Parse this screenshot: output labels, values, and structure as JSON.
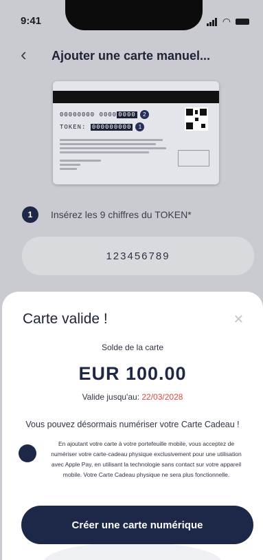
{
  "status_bar": {
    "time": "9:41"
  },
  "header": {
    "back_icon": "chevron-left-icon",
    "title": "Ajouter une carte manuel..."
  },
  "card_preview": {
    "card_number_prefix": "00000000 0000",
    "card_number_highlight": "0000",
    "card_number_badge": "2",
    "token_label": "TOKEN:",
    "token_highlight": "000000000",
    "token_badge": "1"
  },
  "step": {
    "number": "1",
    "text": "Insérez les 9 chiffres du TOKEN*"
  },
  "token_input": {
    "value": "123456789"
  },
  "sheet": {
    "title": "Carte valide !",
    "close_icon": "close-icon",
    "balance_label": "Solde de la carte",
    "balance_amount": "EUR 100.00",
    "valid_until_label": "Valide jusqu'au:",
    "valid_until_date": "22/03/2028",
    "message": "Vous pouvez désormais numériser votre Carte Cadeau !",
    "disclaimer": "En ajoutant votre carte à votre portefeuille mobile, vous acceptez de numériser votre carte-cadeau physique exclusivement pour une utilisation avec Apple Pay, en utilisant la technologie sans contact sur votre appareil mobile. Votre Carte Cadeau physique ne sera plus fonctionnelle.",
    "cta_label": "Créer une carte numérique"
  },
  "colors": {
    "primary": "#1d2747",
    "date_red": "#e0473d",
    "overlay": "#c9cbd1"
  }
}
